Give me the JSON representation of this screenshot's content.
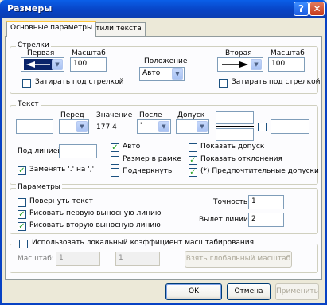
{
  "window": {
    "title": "Размеры"
  },
  "title_buttons": {
    "help": "?",
    "close": "✕"
  },
  "tabs": [
    {
      "label": "Основные параметры"
    },
    {
      "label": "Стили текста"
    }
  ],
  "arrows": {
    "legend": "Стрелки",
    "first_label": "Первая",
    "scale1_label": "Масштаб",
    "scale1_value": "100",
    "position_label": "Положение",
    "position_value": "Авто",
    "second_label": "Вторая",
    "scale2_label": "Масштаб",
    "scale2_value": "100",
    "fill1_label": "Затирать под стрелкой",
    "fill2_label": "Затирать под стрелкой"
  },
  "text": {
    "legend": "Текст",
    "before_label": "Перед",
    "value_label": "Значение",
    "value_text": "177.4",
    "after_label": "После",
    "after_value": "'",
    "tolerance_label": "Допуск",
    "underline_label": "Под линией",
    "replace_label": "Заменять '.' на ','",
    "auto_label": "Авто",
    "frame_label": "Размер в рамке",
    "underline2_label": "Подчеркнуть",
    "show_tol_label": "Показать допуск",
    "show_dev_label": "Показать отклонения",
    "pref_tol_label": "(*) Предпочтительные допуски"
  },
  "params": {
    "legend": "Параметры",
    "rotate_label": "Повернуть текст",
    "draw1_label": "Рисовать первую выносную линию",
    "draw2_label": "Рисовать вторую выносную линию",
    "precision_label": "Точность",
    "precision_value": "1",
    "ext_label": "Вылет линии",
    "ext_value": "2"
  },
  "local_scale": {
    "legend": "Использовать локальный коэффициент масштабирования",
    "scale_label": "Масштаб:",
    "scale_a": "1",
    "colon": ":",
    "scale_b": "1",
    "global_button": "Взять глобальный масштаб"
  },
  "footer": {
    "ok": "OK",
    "cancel": "Отмена",
    "apply": "Применить"
  },
  "checkbox_states": {
    "fill1": false,
    "fill2": false,
    "tol_box": false,
    "replace": true,
    "auto": true,
    "frame": false,
    "underline2": false,
    "show_tol": false,
    "show_dev": true,
    "pref_tol": true,
    "rotate": false,
    "draw1": true,
    "draw2": true,
    "local_scale": false
  },
  "colors": {
    "title_bar": "#0A5FE8",
    "dialog_bg": "#ECE9D8",
    "panel_bg": "#FCFCFE",
    "check_mark": "#21A121"
  }
}
